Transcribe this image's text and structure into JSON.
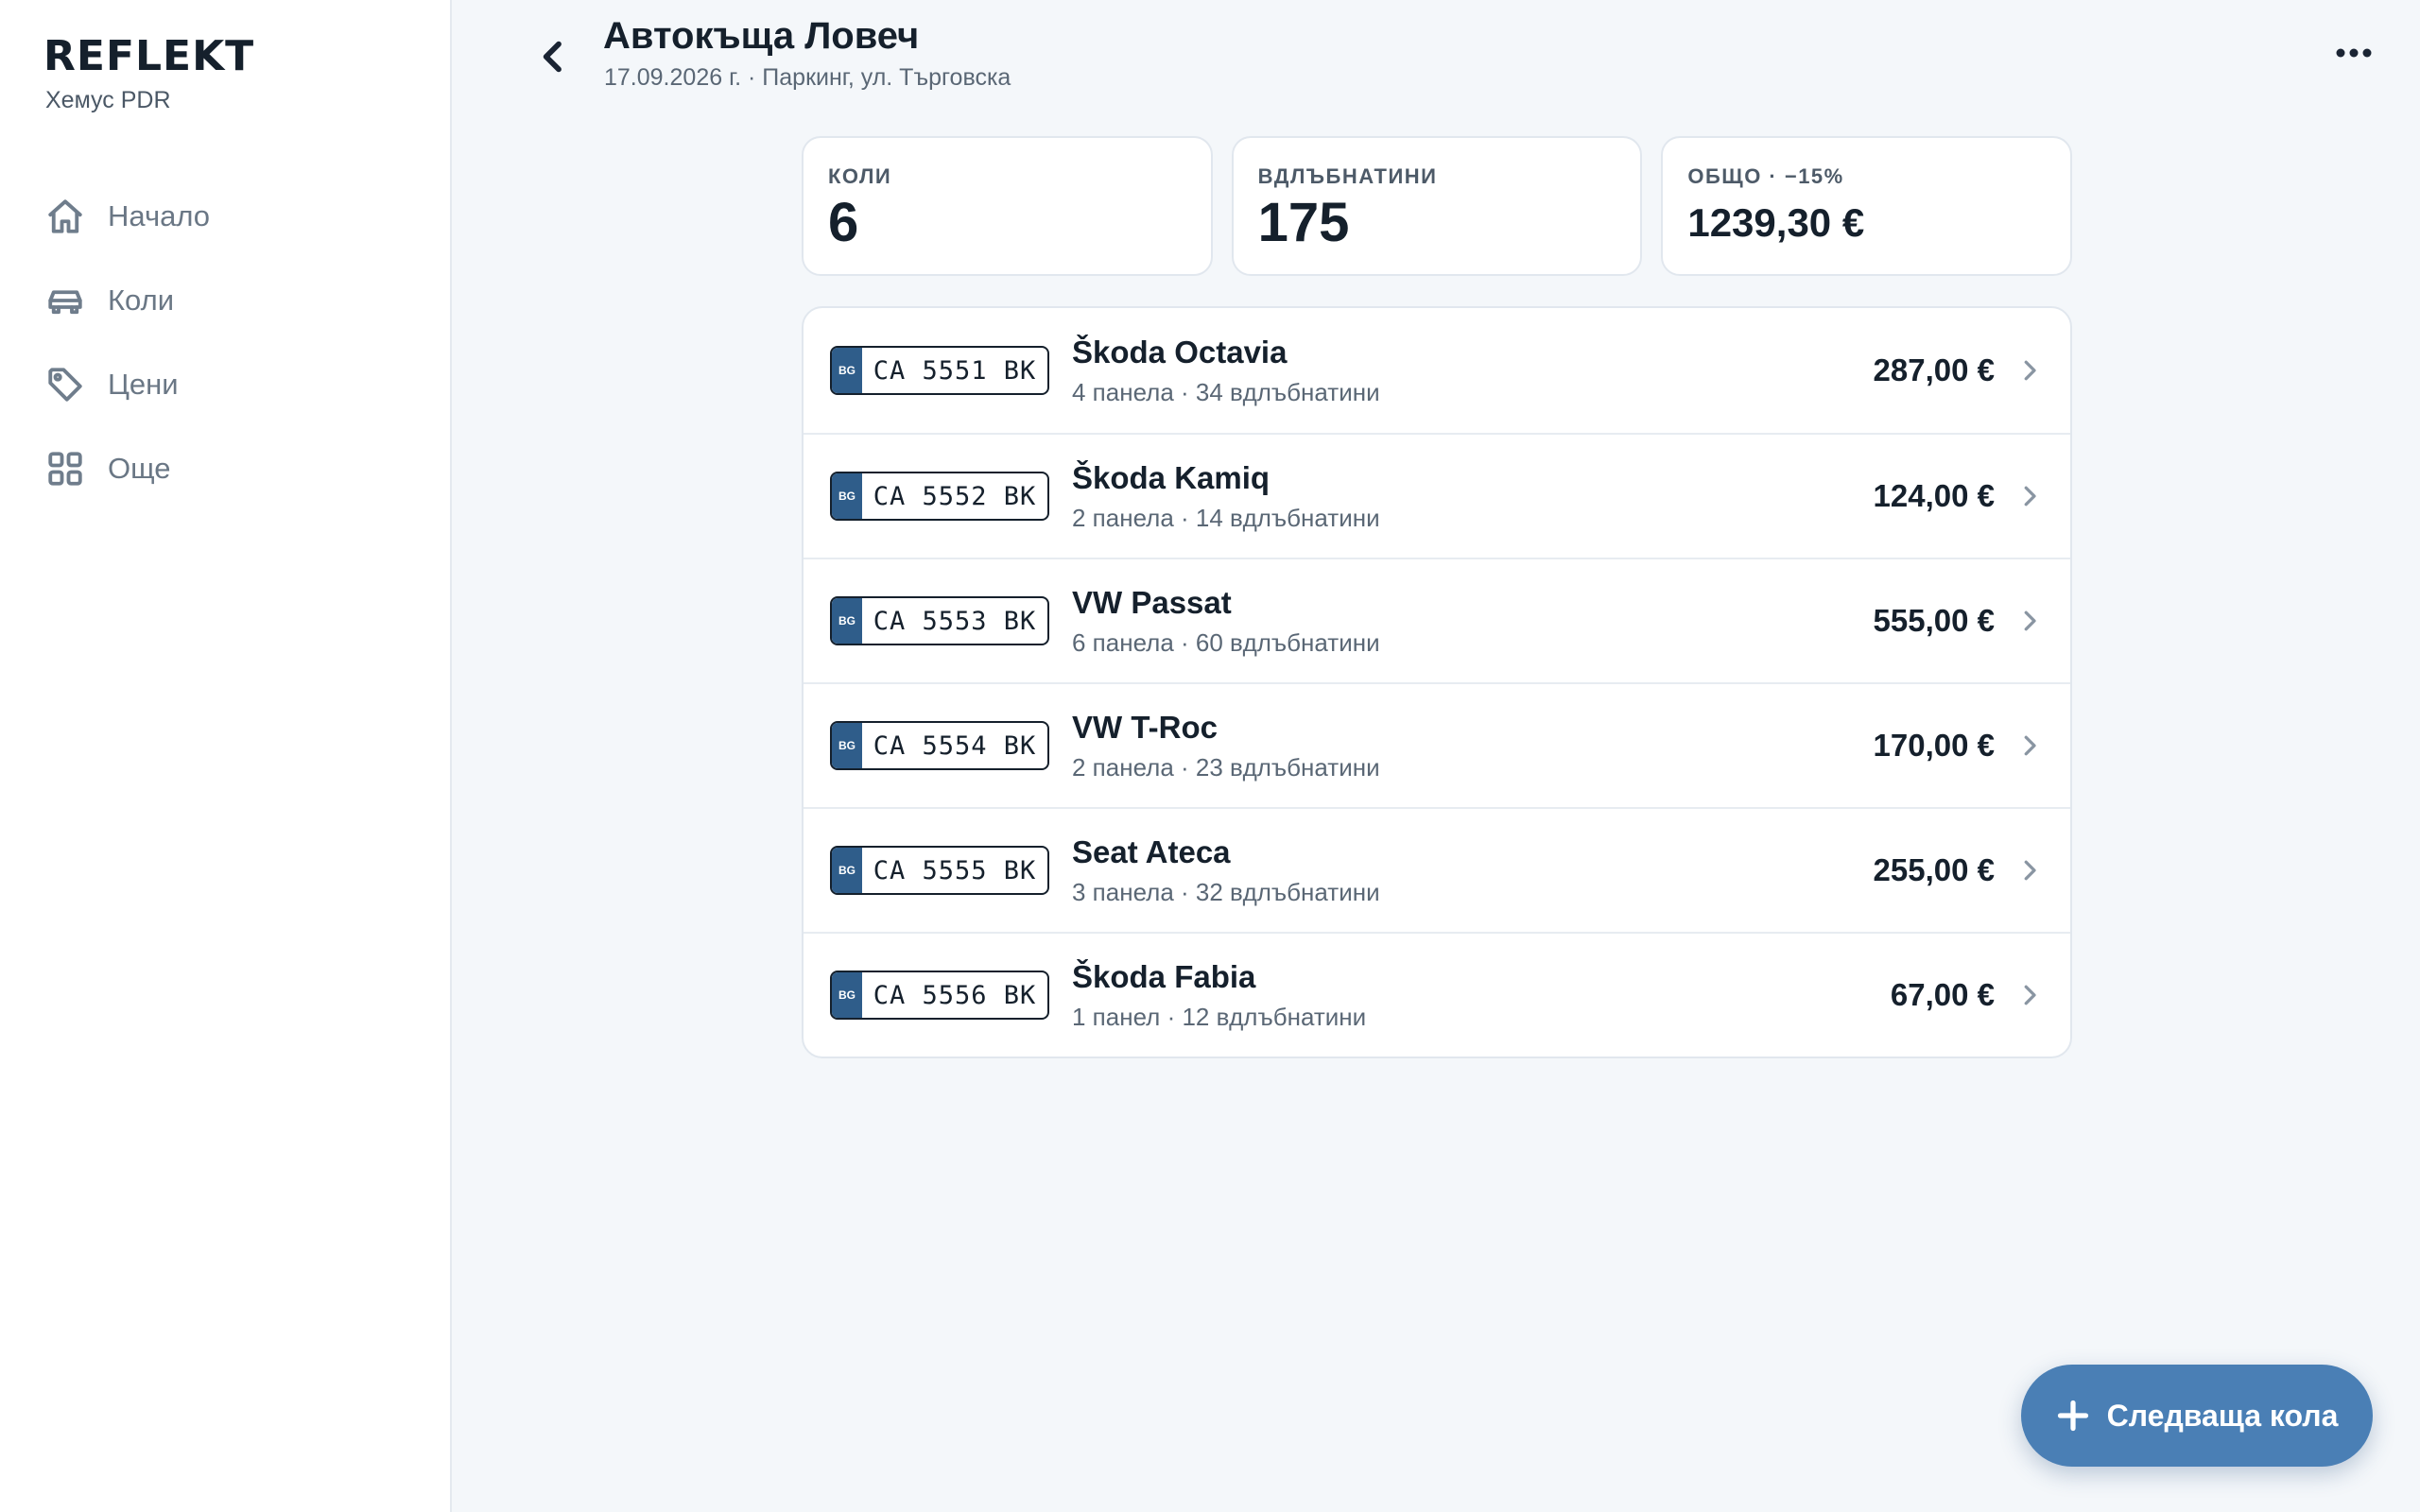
{
  "app": {
    "logo": "REFLEKT",
    "company": "Хемус PDR"
  },
  "sidebar": {
    "items": [
      {
        "label": "Начало",
        "icon": "home-icon"
      },
      {
        "label": "Коли",
        "icon": "car-icon"
      },
      {
        "label": "Цени",
        "icon": "tag-icon"
      },
      {
        "label": "Още",
        "icon": "grid-icon"
      }
    ]
  },
  "header": {
    "title": "Автокъща Ловеч",
    "subtitle": "17.09.2026 г. · Паркинг, ул. Търговска"
  },
  "stats": {
    "cars": {
      "label": "КОЛИ",
      "value": "6"
    },
    "dents": {
      "label": "ВДЛЪБНАТИНИ",
      "value": "175"
    },
    "total": {
      "label": "ОБЩО · −15%",
      "value": "1239,30 €"
    }
  },
  "cars": [
    {
      "plate_country": "BG",
      "plate": "CA 5551 BK",
      "name": "Škoda Octavia",
      "meta": "4 панела · 34 вдлъбнатини",
      "price": "287,00 €"
    },
    {
      "plate_country": "BG",
      "plate": "CA 5552 BK",
      "name": "Škoda Kamiq",
      "meta": "2 панела · 14 вдлъбнатини",
      "price": "124,00 €"
    },
    {
      "plate_country": "BG",
      "plate": "CA 5553 BK",
      "name": "VW Passat",
      "meta": "6 панела · 60 вдлъбнатини",
      "price": "555,00 €"
    },
    {
      "plate_country": "BG",
      "plate": "CA 5554 BK",
      "name": "VW T-Roc",
      "meta": "2 панела · 23 вдлъбнатини",
      "price": "170,00 €"
    },
    {
      "plate_country": "BG",
      "plate": "CA 5555 BK",
      "name": "Seat Ateca",
      "meta": "3 панела · 32 вдлъбнатини",
      "price": "255,00 €"
    },
    {
      "plate_country": "BG",
      "plate": "CA 5556 BK",
      "name": "Škoda Fabia",
      "meta": "1 панел · 12 вдлъбнатини",
      "price": "67,00 €"
    }
  ],
  "fab": {
    "label": "Следваща кола",
    "icon": "plus-icon"
  },
  "colors": {
    "accent": "#4a7fb5",
    "plate_band": "#2f5d8a",
    "background": "#f4f7fa"
  }
}
